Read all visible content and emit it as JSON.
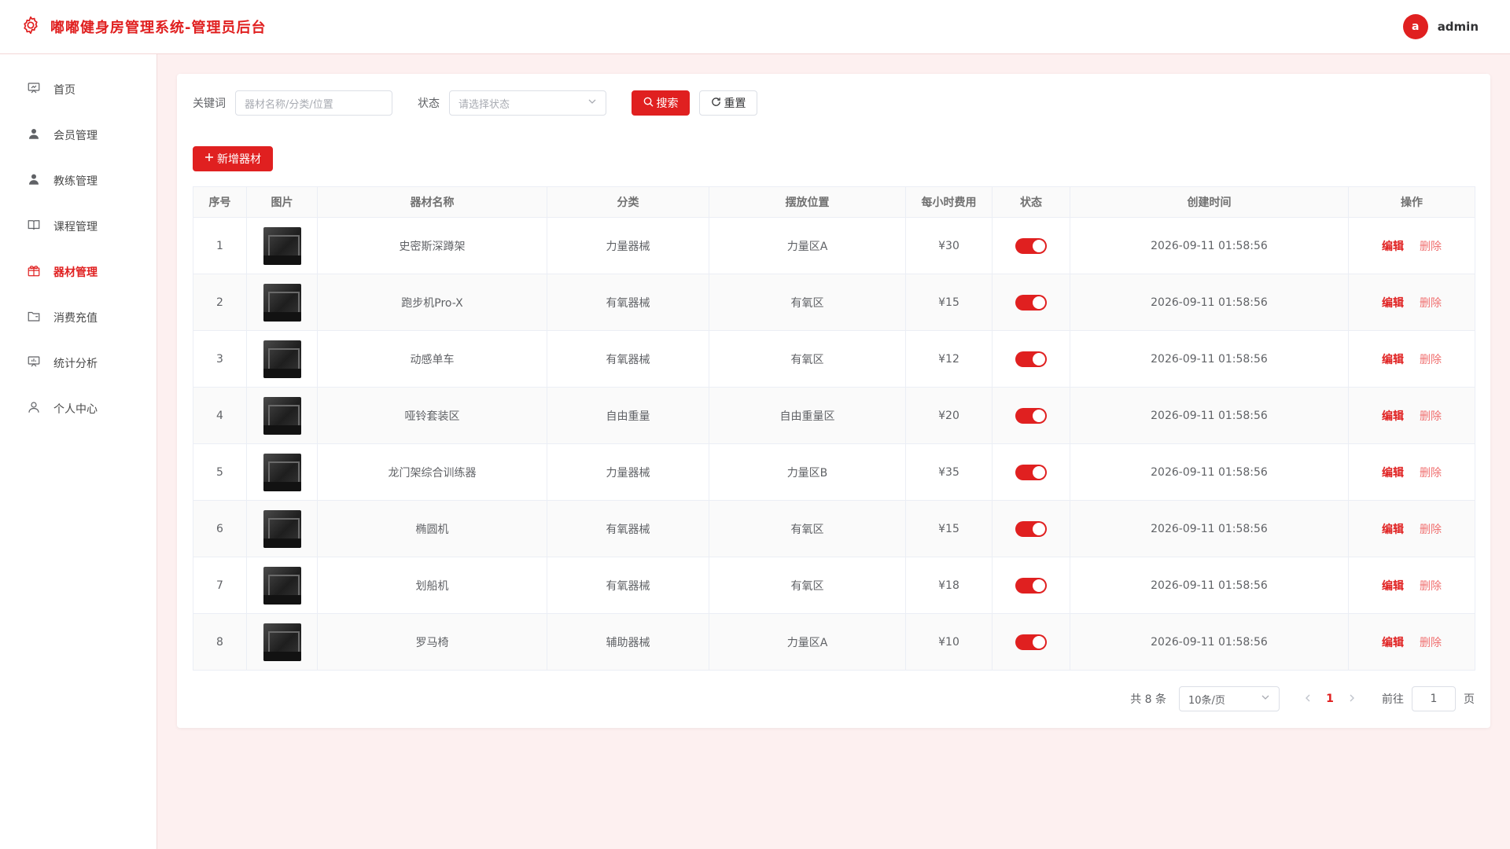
{
  "header": {
    "title": "嘟嘟健身房管理系统-管理员后台",
    "avatar_letter": "a",
    "username": "admin"
  },
  "sidebar": {
    "items": [
      {
        "label": "首页",
        "icon": "home-icon",
        "active": false
      },
      {
        "label": "会员管理",
        "icon": "member-icon",
        "active": false
      },
      {
        "label": "教练管理",
        "icon": "coach-icon",
        "active": false
      },
      {
        "label": "课程管理",
        "icon": "book-icon",
        "active": false
      },
      {
        "label": "器材管理",
        "icon": "equipment-icon",
        "active": true
      },
      {
        "label": "消费充值",
        "icon": "wallet-icon",
        "active": false
      },
      {
        "label": "统计分析",
        "icon": "chart-icon",
        "active": false
      },
      {
        "label": "个人中心",
        "icon": "user-icon",
        "active": false
      }
    ]
  },
  "filters": {
    "keyword_label": "关键词",
    "keyword_placeholder": "器材名称/分类/位置",
    "status_label": "状态",
    "status_placeholder": "请选择状态",
    "search_label": "搜索",
    "reset_label": "重置"
  },
  "toolbar": {
    "add_label": "新增器材"
  },
  "table": {
    "columns": [
      "序号",
      "图片",
      "器材名称",
      "分类",
      "摆放位置",
      "每小时费用",
      "状态",
      "创建时间",
      "操作"
    ],
    "edit_label": "编辑",
    "delete_label": "删除",
    "rows": [
      {
        "index": "1",
        "name": "史密斯深蹲架",
        "category": "力量器械",
        "location": "力量区A",
        "fee": "¥30",
        "enabled": true,
        "created": "2026-09-11 01:58:56"
      },
      {
        "index": "2",
        "name": "跑步机Pro-X",
        "category": "有氧器械",
        "location": "有氧区",
        "fee": "¥15",
        "enabled": true,
        "created": "2026-09-11 01:58:56"
      },
      {
        "index": "3",
        "name": "动感单车",
        "category": "有氧器械",
        "location": "有氧区",
        "fee": "¥12",
        "enabled": true,
        "created": "2026-09-11 01:58:56"
      },
      {
        "index": "4",
        "name": "哑铃套装区",
        "category": "自由重量",
        "location": "自由重量区",
        "fee": "¥20",
        "enabled": true,
        "created": "2026-09-11 01:58:56"
      },
      {
        "index": "5",
        "name": "龙门架综合训练器",
        "category": "力量器械",
        "location": "力量区B",
        "fee": "¥35",
        "enabled": true,
        "created": "2026-09-11 01:58:56"
      },
      {
        "index": "6",
        "name": "椭圆机",
        "category": "有氧器械",
        "location": "有氧区",
        "fee": "¥15",
        "enabled": true,
        "created": "2026-09-11 01:58:56"
      },
      {
        "index": "7",
        "name": "划船机",
        "category": "有氧器械",
        "location": "有氧区",
        "fee": "¥18",
        "enabled": true,
        "created": "2026-09-11 01:58:56"
      },
      {
        "index": "8",
        "name": "罗马椅",
        "category": "辅助器械",
        "location": "力量区A",
        "fee": "¥10",
        "enabled": true,
        "created": "2026-09-11 01:58:56"
      }
    ]
  },
  "pagination": {
    "total_text": "共 8 条",
    "page_size": "10条/页",
    "current_page": "1",
    "goto_label": "前往",
    "goto_value": "1",
    "page_suffix": "页"
  },
  "colors": {
    "accent": "#e02020",
    "background": "#fdf0f0"
  }
}
